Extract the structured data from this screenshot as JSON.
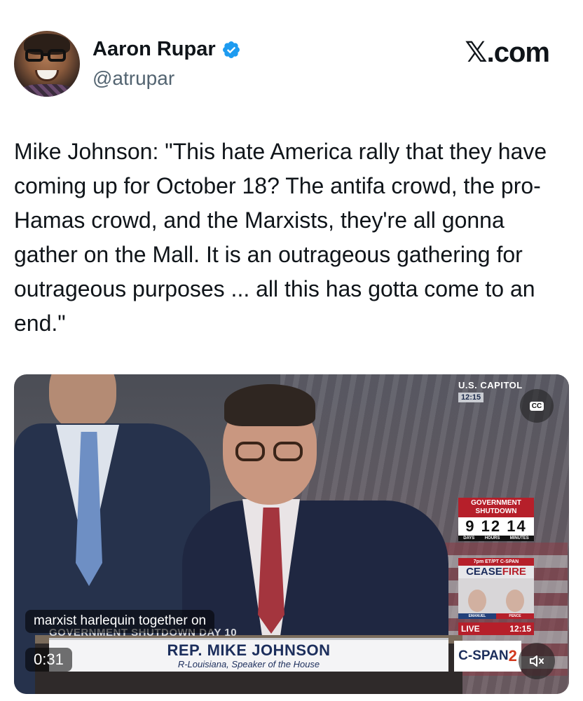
{
  "author": {
    "name": "Aaron Rupar",
    "handle": "@atrupar",
    "verified_icon": "verified-badge-icon",
    "verified_color": "#1d9bf0"
  },
  "site_logo": "𝕏.com",
  "tweet": {
    "text": "Mike Johnson: \"This hate America rally that they have coming up for October 18? The antifa crowd, the pro-Hamas crowd, and the Marxists, they're all gonna gather on the Mall. It is an outrageous gathering for outrageous purposes ... all this has gotta come to an end.\""
  },
  "video": {
    "caption": "marxist harlequin together on",
    "timecode": "0:31",
    "cc_label": "CC",
    "mute_icon": "speaker-muted-icon",
    "bug": {
      "title": "U.S. CAPITOL",
      "time": "12:15"
    },
    "shutdown": {
      "label": "GOVERNMENT SHUTDOWN",
      "count": "9 12 14",
      "units": [
        "DAYS",
        "HOURS",
        "MINUTES"
      ]
    },
    "ceasefire": {
      "label": "7pm ET/PT C-SPAN",
      "title_a": "CEASE",
      "title_b": "FIRE",
      "guest_left": "EMANUEL",
      "guest_right": "PENCE"
    },
    "live": {
      "label": "LIVE",
      "time": "12:15"
    },
    "strip_text": "GOVERNMENT SHUTDOWN DAY 10",
    "lower_third": {
      "name": "REP. MIKE JOHNSON",
      "subtitle": "R-Louisiana, Speaker of the House"
    },
    "network": {
      "name": "C-SPAN",
      "number": "2"
    }
  }
}
